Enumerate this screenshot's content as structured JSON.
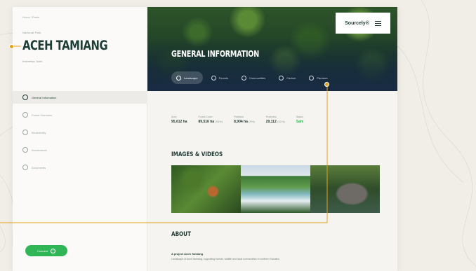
{
  "sidebar": {
    "breadcrumb": "Home / Parks",
    "eyebrow": "National Park",
    "title": "ACEH TAMIANG",
    "subtitle": "Indonesia, Aceh",
    "nav": [
      {
        "label": "General Information",
        "active": true,
        "icon": "info-icon"
      },
      {
        "label": "Forest Overview",
        "active": false,
        "icon": "tree-icon"
      },
      {
        "label": "Biodiversity",
        "active": false,
        "icon": "leaf-icon"
      },
      {
        "label": "Investments",
        "active": false,
        "icon": "chart-icon"
      },
      {
        "label": "Documents",
        "active": false,
        "icon": "doc-icon"
      }
    ],
    "connect_label": "Connect"
  },
  "header": {
    "brand": "Sourcely®",
    "hero_title": "GENERAL INFORMATION",
    "tabs": [
      {
        "label": "Landscape",
        "active": true
      },
      {
        "label": "Forests",
        "active": false
      },
      {
        "label": "Communities",
        "active": false
      },
      {
        "label": "Carbon",
        "active": false
      },
      {
        "label": "Partners",
        "active": false
      }
    ]
  },
  "stats": [
    {
      "label": "Area",
      "value": "95,612 ha",
      "unit": ""
    },
    {
      "label": "Forest Cover",
      "value": "89,516 ha",
      "unit": "(93%)"
    },
    {
      "label": "Peatland",
      "value": "8,904 ha",
      "unit": "(9%)"
    },
    {
      "label": "Protected",
      "value": "29,112",
      "unit": "(31%)"
    },
    {
      "label": "Status",
      "value": "Safe",
      "unit": ""
    }
  ],
  "sections": {
    "gallery_title": "IMAGES & VIDEOS",
    "about_title": "ABOUT",
    "about_subtitle": "A project Aceh Tamiang",
    "about_text": "Landscape of Aceh Tamiang, supporting forests, wildlife and local communities in northern Sumatra."
  },
  "colors": {
    "accent": "#31b657",
    "callout": "#e0a21c",
    "dark": "#1f3a34"
  }
}
